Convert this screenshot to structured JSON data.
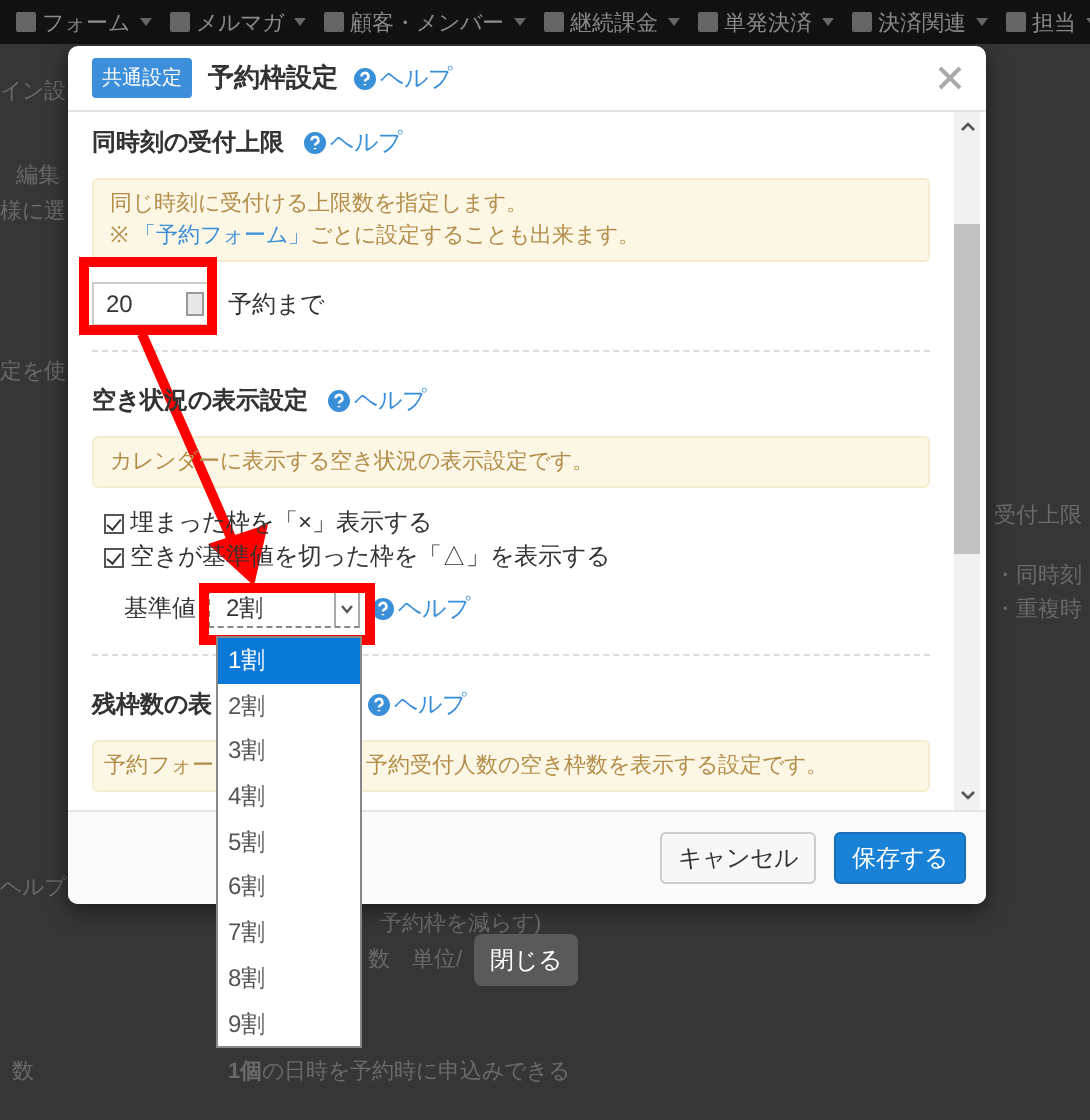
{
  "nav": {
    "items": [
      "フォーム",
      "メルマガ",
      "顧客・メンバー",
      "継続課金",
      "単発決済",
      "決済関連",
      "担当"
    ]
  },
  "backdrop_texts": [
    "イン設",
    "編集",
    "様に選",
    "定を使",
    "受付上限",
    "・同時刻",
    "・重複時",
    "ヘルプ",
    "予約枠を減らす)",
    "数　単位/",
    "数",
    "**1個**の日時を予約時に申込みできる"
  ],
  "dialog": {
    "badge": "共通設定",
    "title": "予約枠設定",
    "help": "ヘルプ",
    "sections": [
      {
        "title": "同時刻の受付上限",
        "help": "ヘルプ",
        "split": false,
        "notes": [
          {
            "text": "同じ時刻に受付ける上限数を指定します。"
          },
          {
            "text": "※ ",
            "link": "「予約フォーム」",
            "after": "ごとに設定することも出来ます。"
          }
        ],
        "number_field": {
          "value": "20",
          "suffix": "予約まで"
        }
      },
      {
        "title": "空き状況の表示設定",
        "help": "ヘルプ",
        "split": false,
        "notes": [
          {
            "text": "カレンダーに表示する空き状況の表示設定です。"
          }
        ],
        "checkboxes": [
          {
            "label": "埋まった枠を「×」表示する",
            "checked": true
          },
          {
            "label": "空きが基準値を切った枠を「△」を表示する",
            "checked": true
          }
        ],
        "select": {
          "label": "基準値",
          "value": "2割",
          "help": "ヘルプ",
          "options": [
            {
              "label": "1割",
              "highlighted": true
            },
            {
              "label": "2割",
              "highlighted": false
            },
            {
              "label": "3割",
              "highlighted": false
            },
            {
              "label": "4割",
              "highlighted": false
            },
            {
              "label": "5割",
              "highlighted": false
            },
            {
              "label": "6割",
              "highlighted": false
            },
            {
              "label": "7割",
              "highlighted": false
            },
            {
              "label": "8割",
              "highlighted": false
            },
            {
              "label": "9割",
              "highlighted": false
            }
          ]
        }
      },
      {
        "title": "残枠数の表",
        "help": "ヘルプ",
        "split": true,
        "notes": [
          {
            "text": "予約フォー"
          },
          {
            "text": "予約受付人数の空き枠数を表示する設定です。"
          }
        ]
      }
    ],
    "buttons": [
      {
        "label": "キャンセル",
        "kind": "default"
      },
      {
        "label": "保存する",
        "kind": "primary"
      }
    ]
  },
  "tooltip": "閉じる"
}
